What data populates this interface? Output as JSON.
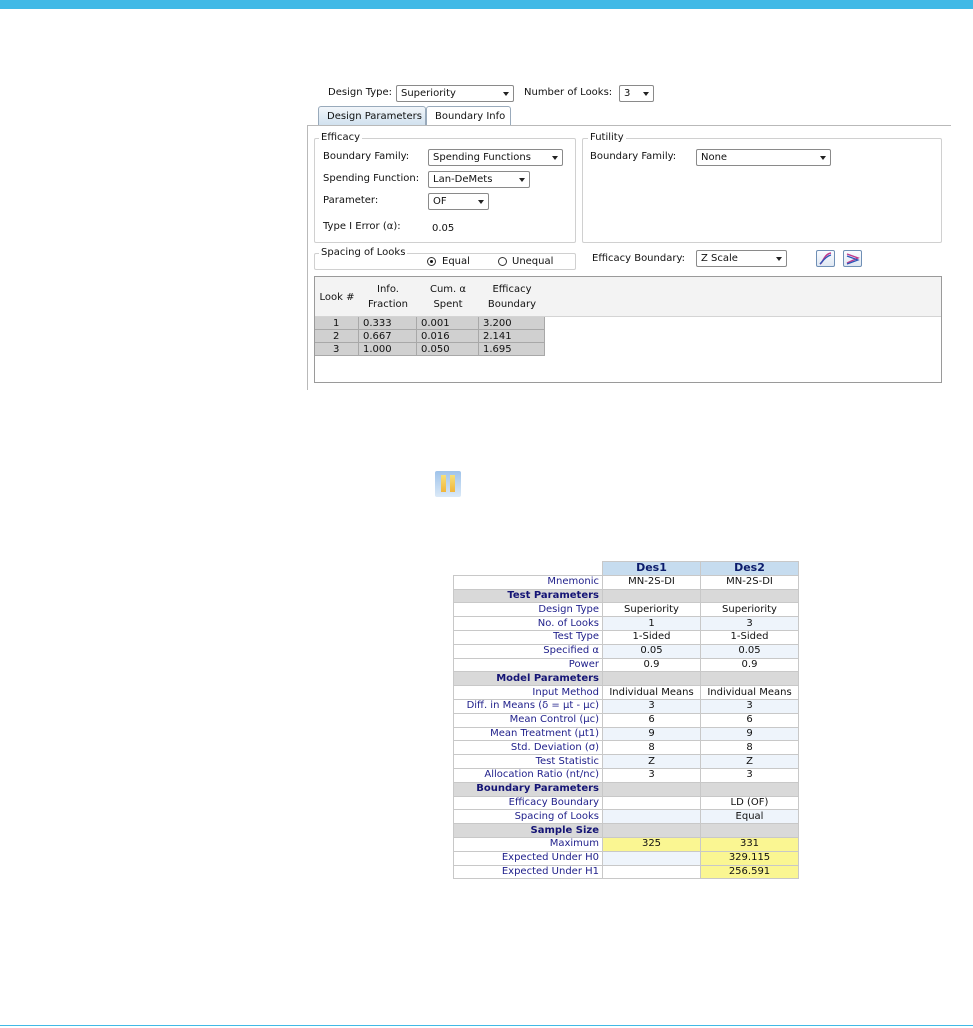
{
  "dialog": {
    "design_type_label": "Design Type:",
    "design_type_value": "Superiority",
    "num_looks_label": "Number of Looks:",
    "num_looks_value": "3",
    "tabs": [
      {
        "label": "Design Parameters",
        "active": false
      },
      {
        "label": "Boundary Info",
        "active": true
      }
    ],
    "efficacy": {
      "title": "Efficacy",
      "boundary_family_label": "Boundary Family:",
      "boundary_family_value": "Spending Functions",
      "spending_function_label": "Spending Function:",
      "spending_function_value": "Lan-DeMets",
      "parameter_label": "Parameter:",
      "parameter_value": "OF",
      "type1_error_label": "Type I Error (α):",
      "type1_error_value": "0.05"
    },
    "futility": {
      "title": "Futility",
      "boundary_family_label": "Boundary Family:",
      "boundary_family_value": "None"
    },
    "spacing": {
      "title": "Spacing of Looks",
      "options": [
        "Equal",
        "Unequal"
      ],
      "selected": "Equal"
    },
    "efficacy_boundary_label": "Efficacy Boundary:",
    "efficacy_boundary_value": "Z Scale",
    "icons": [
      "boundary-chart-icon",
      "error-spending-chart-icon"
    ],
    "grid": {
      "headers": [
        "Look #",
        "Info.\nFraction",
        "Cum. α\nSpent",
        "Efficacy\nBoundary"
      ],
      "rows": [
        [
          "1",
          "0.333",
          "0.001",
          "3.200"
        ],
        [
          "2",
          "0.667",
          "0.016",
          "2.141"
        ],
        [
          "3",
          "1.000",
          "0.050",
          "1.695"
        ]
      ]
    }
  },
  "compare_icon": "compare-designs-icon",
  "comparison": {
    "columns": [
      "Des1",
      "Des2"
    ],
    "rows": [
      {
        "label": "Mnemonic",
        "values": [
          "MN-2S-DI",
          "MN-2S-DI"
        ]
      },
      {
        "section": "Test Parameters"
      },
      {
        "label": "Design Type",
        "values": [
          "Superiority",
          "Superiority"
        ]
      },
      {
        "label": "No. of Looks",
        "values": [
          "1",
          "3"
        ]
      },
      {
        "label": "Test Type",
        "values": [
          "1-Sided",
          "1-Sided"
        ]
      },
      {
        "label": "Specified α",
        "values": [
          "0.05",
          "0.05"
        ]
      },
      {
        "label": "Power",
        "values": [
          "0.9",
          "0.9"
        ]
      },
      {
        "section": "Model Parameters"
      },
      {
        "label": "Input Method",
        "values": [
          "Individual Means",
          "Individual Means"
        ]
      },
      {
        "label": "Diff. in Means (δ = μt - μc)",
        "values": [
          "3",
          "3"
        ]
      },
      {
        "label": "Mean Control (μc)",
        "values": [
          "6",
          "6"
        ]
      },
      {
        "label": "Mean Treatment (μt1)",
        "values": [
          "9",
          "9"
        ]
      },
      {
        "label": "Std. Deviation (σ)",
        "values": [
          "8",
          "8"
        ]
      },
      {
        "label": "Test Statistic",
        "values": [
          "Z",
          "Z"
        ]
      },
      {
        "label": "Allocation Ratio (nt/nc)",
        "values": [
          "3",
          "3"
        ]
      },
      {
        "section": "Boundary Parameters"
      },
      {
        "label": "Efficacy Boundary",
        "values": [
          "",
          "LD (OF)"
        ]
      },
      {
        "label": "Spacing of Looks",
        "values": [
          "",
          "Equal"
        ]
      },
      {
        "section": "Sample Size"
      },
      {
        "label": "Maximum",
        "values": [
          "325",
          "331"
        ],
        "highlight": [
          true,
          true
        ]
      },
      {
        "label": "Expected Under H0",
        "values": [
          "",
          "329.115"
        ],
        "highlight": [
          false,
          true
        ]
      },
      {
        "label": "Expected Under H1",
        "values": [
          "",
          "256.591"
        ],
        "highlight": [
          false,
          true
        ]
      }
    ]
  },
  "colors": {
    "accent_bar": "#41b9e6",
    "header_blue": "#c6dcef",
    "section_gray": "#d9d9d9",
    "highlight_yellow": "#faf692"
  }
}
